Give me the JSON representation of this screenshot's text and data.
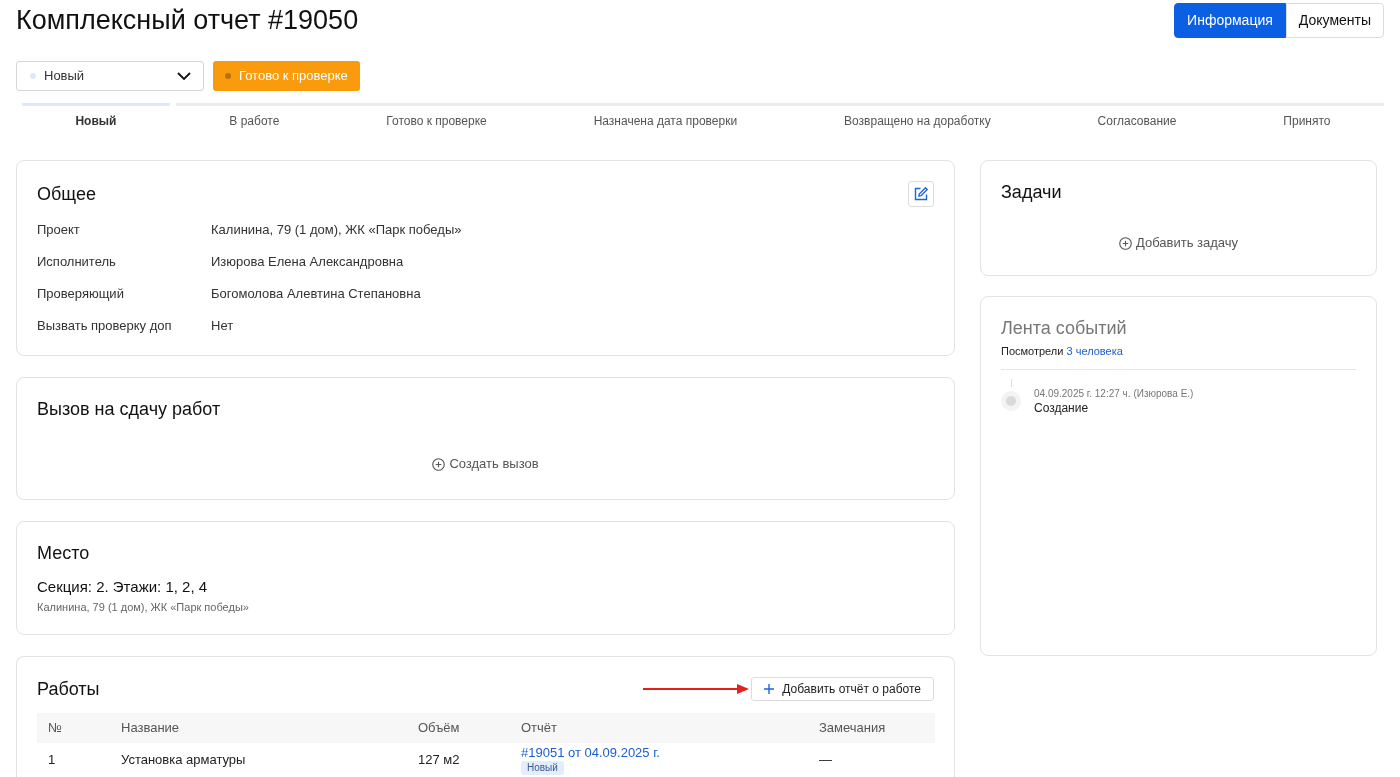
{
  "header": {
    "title": "Комплексный отчет #19050",
    "tabs": [
      {
        "label": "Информация",
        "selected": true
      },
      {
        "label": "Документы",
        "selected": false
      }
    ]
  },
  "status_controls": {
    "status_select": {
      "value": "Новый"
    },
    "next_status_button": {
      "label": "Готово к проверке"
    }
  },
  "stepper": [
    {
      "label": "Новый",
      "selected": true
    },
    {
      "label": "В работе",
      "selected": false
    },
    {
      "label": "Готово к проверке",
      "selected": false
    },
    {
      "label": "Назначена дата проверки",
      "selected": false
    },
    {
      "label": "Возвращено на доработку",
      "selected": false
    },
    {
      "label": "Согласование",
      "selected": false
    },
    {
      "label": "Принято",
      "selected": false
    }
  ],
  "general": {
    "title": "Общее",
    "fields": [
      {
        "label": "Проект",
        "value": "Калинина, 79 (1 дом), ЖК «Парк победы»"
      },
      {
        "label": "Исполнитель",
        "value": "Изюрова Елена Александровна"
      },
      {
        "label": "Проверяющий",
        "value": "Богомолова Алевтина Степановна"
      },
      {
        "label": "Вызвать проверку доп",
        "value": "Нет"
      }
    ]
  },
  "call": {
    "title": "Вызов на сдачу работ",
    "action": "Создать вызов"
  },
  "place": {
    "title": "Место",
    "summary": "Секция: 2. Этажи: 1, 2, 4",
    "address": "Калинина, 79 (1 дом), ЖК «Парк победы»"
  },
  "works": {
    "title": "Работы",
    "add_button": "Добавить отчёт о работе",
    "columns": [
      "№",
      "Название",
      "Объём",
      "Отчёт",
      "Замечания"
    ],
    "rows": [
      {
        "number": "1",
        "name": "Установка арматуры",
        "volume": "127 м2",
        "report": {
          "link": "#19051 от 04.09.2025 г.",
          "status": "Новый"
        },
        "remarks": "—"
      }
    ]
  },
  "tasks": {
    "title": "Задачи",
    "action": "Добавить задачу"
  },
  "feed": {
    "title": "Лента событий",
    "viewed_label": "Посмотрели",
    "viewed_link": "3 человека",
    "events": [
      {
        "meta": "04.09.2025 г. 12:27 ч. (Изюрова Е.)",
        "text": "Создание"
      }
    ]
  }
}
